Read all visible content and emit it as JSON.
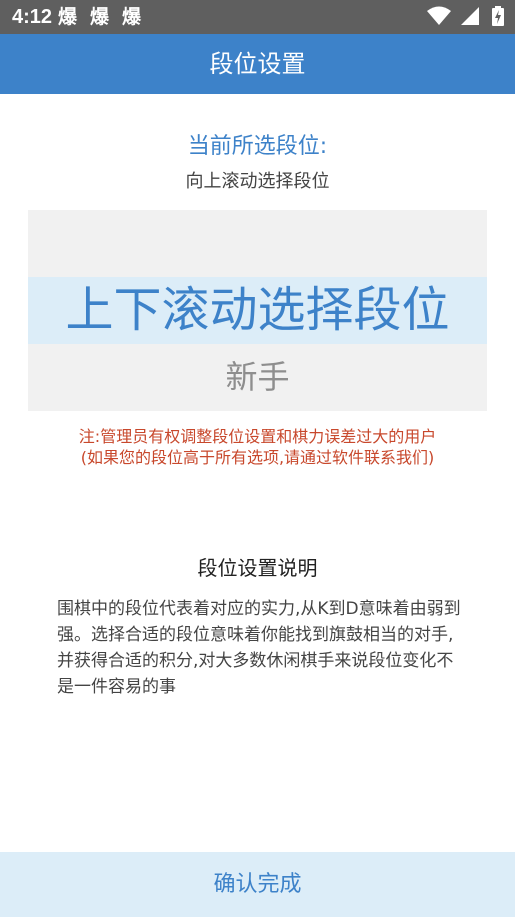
{
  "status_bar": {
    "time": "4:12",
    "notifications": [
      "爆",
      "爆",
      "爆"
    ],
    "icons": [
      "wifi-icon",
      "cell-signal-icon",
      "battery-charging-icon"
    ]
  },
  "app_bar": {
    "title": "段位设置"
  },
  "rank": {
    "current_label": "当前所选段位:",
    "scroll_hint": "向上滚动选择段位",
    "picker": {
      "selected": "上下滚动选择段位",
      "below": "新手"
    }
  },
  "note": {
    "line1": "注:管理员有权调整段位设置和棋力误差过大的用户",
    "line2": "(如果您的段位高于所有选项,请通过软件联系我们)"
  },
  "explanation": {
    "title": "段位设置说明",
    "body": "围棋中的段位代表着对应的实力,从K到D意味着由弱到强。选择合适的段位意味着你能找到旗鼓相当的对手,并获得合适的积分,对大多数休闲棋手来说段位变化不是一件容易的事"
  },
  "actions": {
    "confirm": "确认完成"
  },
  "colors": {
    "primary": "#3d82c9",
    "status_bar": "#5f5f5f",
    "highlight": "#dcedf8",
    "picker_bg": "#f1f1f1",
    "warning": "#c8482c"
  }
}
